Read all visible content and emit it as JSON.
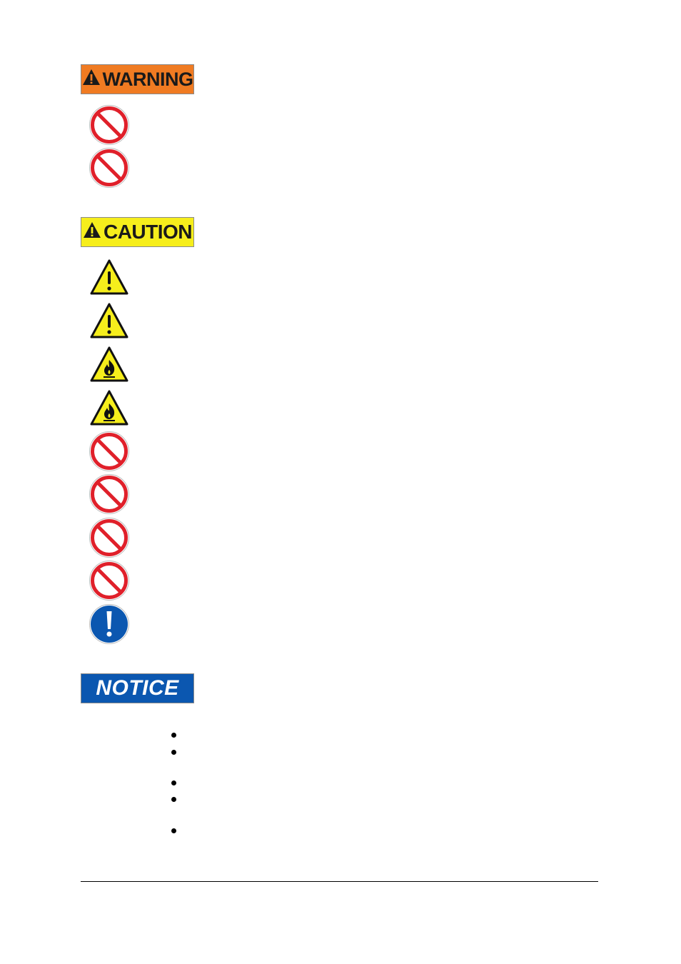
{
  "warning_section": {
    "banner_label": "WARNING",
    "banner_color": "#f07b22",
    "icons": [
      "prohibition-icon",
      "prohibition-icon"
    ]
  },
  "caution_section": {
    "banner_label": "CAUTION",
    "banner_color": "#f6ee1c",
    "icons": [
      "general-warning-icon",
      "general-warning-icon",
      "flammable-warning-icon",
      "flammable-warning-icon",
      "prohibition-icon",
      "prohibition-icon",
      "prohibition-icon",
      "prohibition-icon",
      "mandatory-action-icon"
    ]
  },
  "notice_section": {
    "banner_label": "NOTICE",
    "banner_color": "#0b57b0",
    "bullets": [
      "",
      "",
      "",
      "",
      ""
    ]
  },
  "colors": {
    "prohibition_red": "#e0202a",
    "mandatory_blue": "#0b57b0",
    "hazard_yellow": "#f6ee1c"
  }
}
